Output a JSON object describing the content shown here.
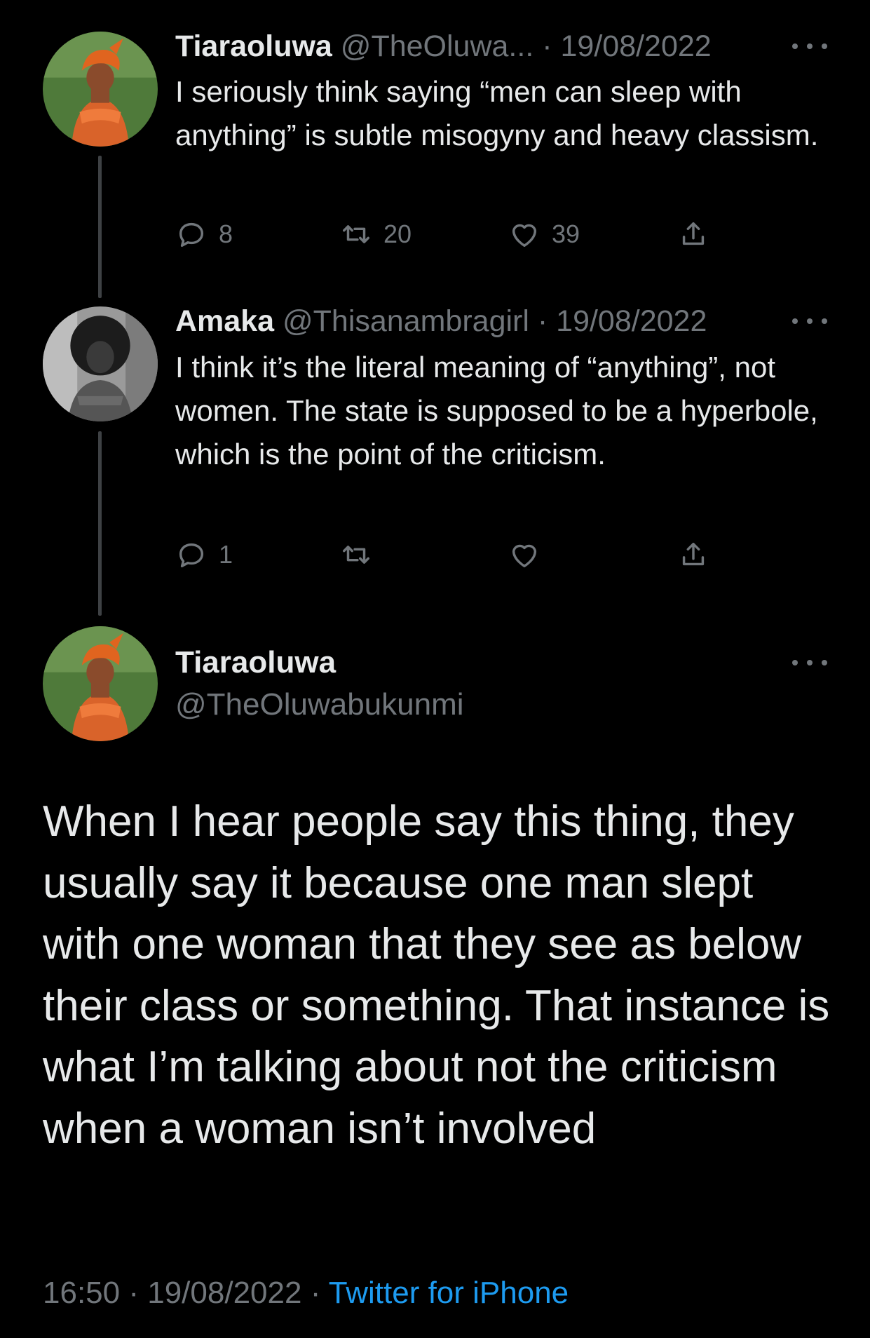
{
  "colors": {
    "background": "#000000",
    "text_primary": "#e7e9ea",
    "text_secondary": "#71767b",
    "link": "#1d9bf0",
    "thread_line": "#3e4144"
  },
  "reply1": {
    "name": "Tiaraoluwa",
    "handle": "@TheOluwa...",
    "sep": "·",
    "date": "19/08/2022",
    "text": "I seriously think saying “men can sleep with anything” is subtle misogyny and heavy classism.",
    "replies": "8",
    "retweets": "20",
    "likes": "39",
    "avatar_icon": "profile-photo-woman-orange-headwrap"
  },
  "reply2": {
    "name": "Amaka",
    "handle": "@Thisanambragirl",
    "sep": "·",
    "date": "19/08/2022",
    "text": "I think it’s the literal meaning of “anything”, not women. The state is supposed to be a hyperbole, which is the point of the criticism.",
    "replies": "1",
    "avatar_icon": "profile-photo-grayscale-woman"
  },
  "main": {
    "name": "Tiaraoluwa",
    "handle": "@TheOluwabukunmi",
    "text": "When I hear people say this thing, they usually say it because one man slept with one woman that they see as below their class or something. That instance is what I’m talking about not the criticism when a woman isn’t involved",
    "time": "16:50",
    "sep": "·",
    "date": "19/08/2022",
    "source": "Twitter for iPhone"
  },
  "icons": [
    "reply-icon",
    "retweet-icon",
    "like-icon",
    "share-icon",
    "more-icon"
  ]
}
